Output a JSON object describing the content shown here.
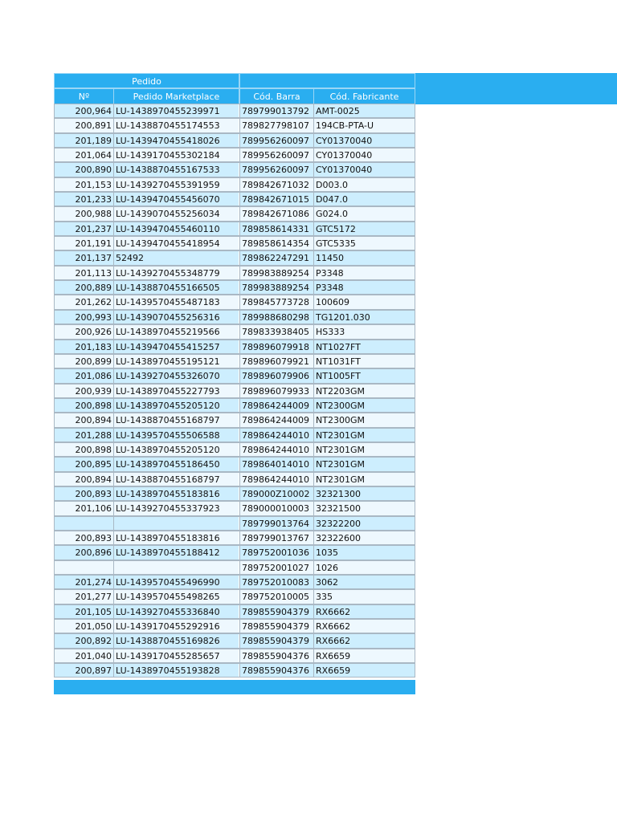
{
  "header": {
    "group_label": "Pedido",
    "columns": [
      "Nº",
      "Pedido Marketplace",
      "Cód. Barra",
      "Cód. Fabricante"
    ]
  },
  "rows": [
    {
      "num": "200,964",
      "mkt": "LU-1438970455239971",
      "barra": "789799013792",
      "fab": "AMT-0025"
    },
    {
      "num": "200,891",
      "mkt": "LU-1438870455174553",
      "barra": "789827798107",
      "fab": "194CB-PTA-U"
    },
    {
      "num": "201,189",
      "mkt": "LU-1439470455418026",
      "barra": "789956260097",
      "fab": "CY01370040"
    },
    {
      "num": "201,064",
      "mkt": "LU-1439170455302184",
      "barra": "789956260097",
      "fab": "CY01370040"
    },
    {
      "num": "200,890",
      "mkt": "LU-1438870455167533",
      "barra": "789956260097",
      "fab": "CY01370040"
    },
    {
      "num": "201,153",
      "mkt": "LU-1439270455391959",
      "barra": "789842671032",
      "fab": "D003.0"
    },
    {
      "num": "201,233",
      "mkt": "LU-1439470455456070",
      "barra": "789842671015",
      "fab": "D047.0"
    },
    {
      "num": "200,988",
      "mkt": "LU-1439070455256034",
      "barra": "789842671086",
      "fab": "G024.0"
    },
    {
      "num": "201,237",
      "mkt": "LU-1439470455460110",
      "barra": "789858614331",
      "fab": "GTC5172"
    },
    {
      "num": "201,191",
      "mkt": "LU-1439470455418954",
      "barra": "789858614354",
      "fab": "GTC5335"
    },
    {
      "num": "201,137",
      "mkt": "52492",
      "barra": "789862247291",
      "fab": "11450"
    },
    {
      "num": "201,113",
      "mkt": "LU-1439270455348779",
      "barra": "789983889254",
      "fab": "P3348"
    },
    {
      "num": "200,889",
      "mkt": "LU-1438870455166505",
      "barra": "789983889254",
      "fab": "P3348"
    },
    {
      "num": "201,262",
      "mkt": "LU-1439570455487183",
      "barra": "789845773728",
      "fab": "100609"
    },
    {
      "num": "200,993",
      "mkt": "LU-1439070455256316",
      "barra": "789988680298",
      "fab": "TG1201.030"
    },
    {
      "num": "200,926",
      "mkt": "LU-1438970455219566",
      "barra": "789833938405",
      "fab": "HS333"
    },
    {
      "num": "201,183",
      "mkt": "LU-1439470455415257",
      "barra": "789896079918",
      "fab": "NT1027FT"
    },
    {
      "num": "200,899",
      "mkt": "LU-1438970455195121",
      "barra": "789896079921",
      "fab": "NT1031FT"
    },
    {
      "num": "201,086",
      "mkt": "LU-1439270455326070",
      "barra": "789896079906",
      "fab": "NT1005FT"
    },
    {
      "num": "200,939",
      "mkt": "LU-1438970455227793",
      "barra": "789896079933",
      "fab": "NT2203GM"
    },
    {
      "num": "200,898",
      "mkt": "LU-1438970455205120",
      "barra": "789864244009",
      "fab": "NT2300GM"
    },
    {
      "num": "200,894",
      "mkt": "LU-1438870455168797",
      "barra": "789864244009",
      "fab": "NT2300GM"
    },
    {
      "num": "201,288",
      "mkt": "LU-1439570455506588",
      "barra": "789864244010",
      "fab": "NT2301GM"
    },
    {
      "num": "200,898",
      "mkt": "LU-1438970455205120",
      "barra": "789864244010",
      "fab": "NT2301GM"
    },
    {
      "num": "200,895",
      "mkt": "LU-1438970455186450",
      "barra": "789864014010",
      "fab": "NT2301GM"
    },
    {
      "num": "200,894",
      "mkt": "LU-1438870455168797",
      "barra": "789864244010",
      "fab": "NT2301GM"
    },
    {
      "num": "200,893",
      "mkt": "LU-1438970455183816",
      "barra": "789000Z10002",
      "fab": "32321300"
    },
    {
      "num": "201,106",
      "mkt": "LU-1439270455337923",
      "barra": "789000010003",
      "fab": "32321500"
    },
    {
      "num": "",
      "mkt": "",
      "barra": "789799013764",
      "fab": "32322200"
    },
    {
      "num": "200,893",
      "mkt": "LU-1438970455183816",
      "barra": "789799013767",
      "fab": "32322600"
    },
    {
      "num": "200,896",
      "mkt": "LU-1438970455188412",
      "barra": "789752001036",
      "fab": "1035"
    },
    {
      "num": "",
      "mkt": "",
      "barra": "789752001027",
      "fab": "1026"
    },
    {
      "num": "201,274",
      "mkt": "LU-1439570455496990",
      "barra": "789752010083",
      "fab": "3062"
    },
    {
      "num": "201,277",
      "mkt": "LU-1439570455498265",
      "barra": "789752010005",
      "fab": "335"
    },
    {
      "num": "201,105",
      "mkt": "LU-1439270455336840",
      "barra": "789855904379",
      "fab": "RX6662"
    },
    {
      "num": "201,050",
      "mkt": "LU-1439170455292916",
      "barra": "789855904379",
      "fab": "RX6662"
    },
    {
      "num": "200,892",
      "mkt": "LU-1438870455169826",
      "barra": "789855904379",
      "fab": "RX6662"
    },
    {
      "num": "201,040",
      "mkt": "LU-1439170455285657",
      "barra": "789855904376",
      "fab": "RX6659"
    },
    {
      "num": "200,897",
      "mkt": "LU-1438970455193828",
      "barra": "789855904376",
      "fab": "RX6659"
    }
  ],
  "colors": {
    "header_blue": "#2aaef0",
    "row_blue": "#cdeefe",
    "row_light": "#eef8fe"
  }
}
